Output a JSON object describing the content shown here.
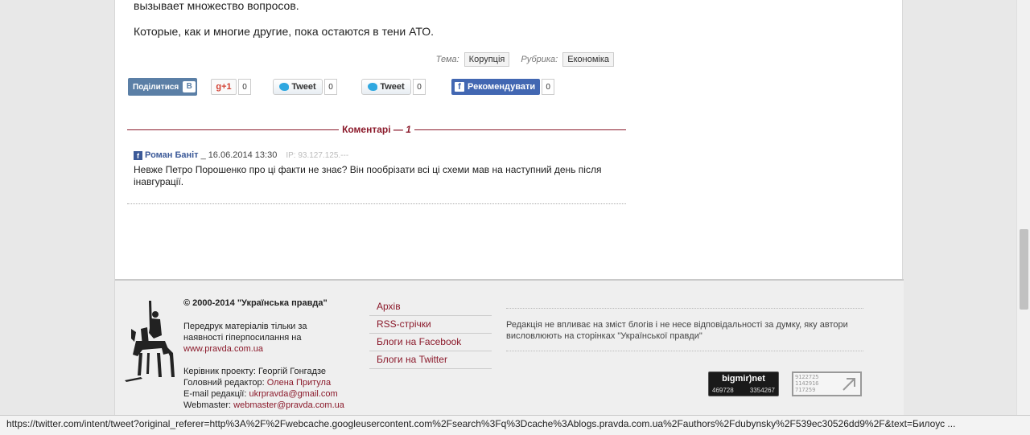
{
  "article": {
    "line1": "вызывает множество вопросов.",
    "line2": "Которые, как и многие другие, пока остаются в тени АТО."
  },
  "tags": {
    "theme_label": "Тема:",
    "theme_value": "Корупція",
    "rubric_label": "Рубрика:",
    "rubric_value": "Економіка"
  },
  "share": {
    "vk_label": "Поділитися",
    "vk_logo": "B",
    "gplus_label": "+1",
    "gplus_count": "0",
    "tweet1_label": "Tweet",
    "tweet1_count": "0",
    "tweet2_label": "Tweet",
    "tweet2_count": "0",
    "fb_label": "Рекомендувати",
    "fb_count": "0"
  },
  "comments": {
    "title": "Коментарі — ",
    "count": "1",
    "items": [
      {
        "author": "Роман Баніт",
        "separator": "_",
        "date": "16.06.2014 13:30",
        "ip": "IP: 93.127.125.---",
        "text": "Невже Петро Порошенко про ці факти не знає? Він пообрізати всі ці схеми мав на наступний день після інавгурації."
      }
    ]
  },
  "footer": {
    "copyright": "© 2000-2014 \"Українська правда\"",
    "reprint_text": "Передрук матеріалів тільки за наявності гіперпосилання на",
    "reprint_link": "www.pravda.com.ua",
    "project_head": "Керівник проекту: Георгій Гонгадзе",
    "chief_editor_label": "Головний редактор: ",
    "chief_editor": "Олена Притула",
    "email_label": "E-mail редакції: ",
    "email": "ukrpravda@gmail.com",
    "webmaster_label": "Webmaster: ",
    "webmaster": "webmaster@pravda.com.ua",
    "links": [
      "Архів",
      "RSS-стрічки",
      "Блоги на Facebook",
      "Блоги на Twitter"
    ],
    "disclaimer": "Редакція не впливає на зміст блогів і не несе відповідальності за думку, яку автори висловлюють на сторінках \"Української правди\"",
    "bigmir": {
      "brand": "bigmir)net",
      "count1": "469728",
      "count2": "3354267"
    },
    "counter2_text": "9122725\n1142916\n717259"
  },
  "statusbar": {
    "url": "https://twitter.com/intent/tweet?original_referer=http%3A%2F%2Fwebcache.googleusercontent.com%2Fsearch%3Fq%3Dcache%3Ablogs.pravda.com.ua%2Fauthors%2Fdubynsky%2F539ec30526dd9%2F&text=Билоус ..."
  },
  "colors": {
    "accent": "#8b1a2b",
    "vk": "#5b7fa6",
    "facebook": "#4267b2",
    "twitter": "#2ea7e0"
  }
}
